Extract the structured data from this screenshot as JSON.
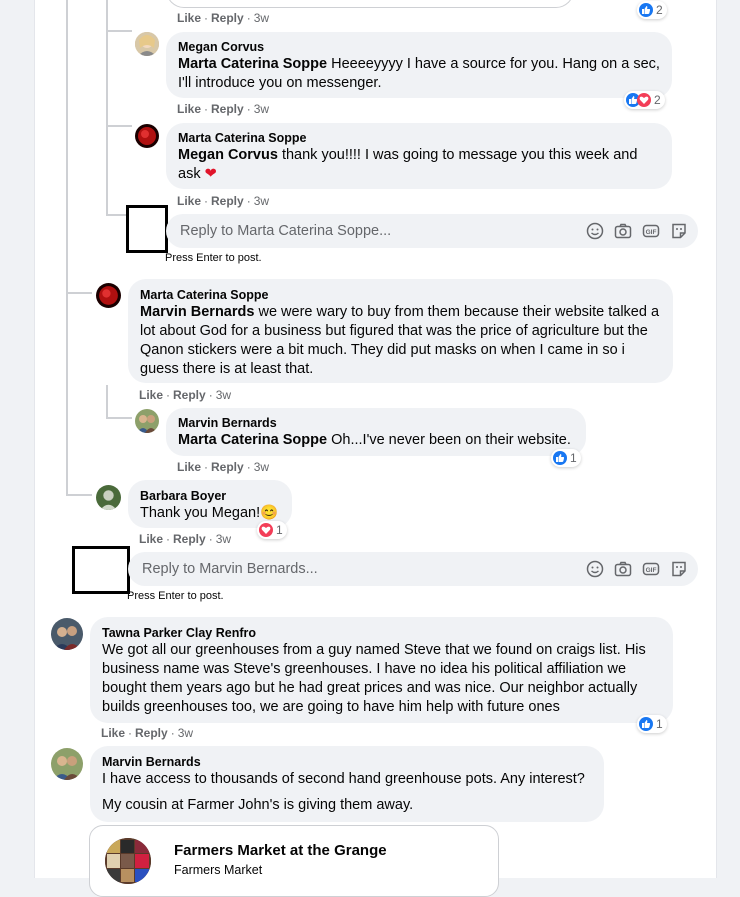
{
  "top_meta": {
    "like": "Like",
    "reply": "Reply",
    "time": "3w",
    "reactions": "2"
  },
  "comments": {
    "c1": {
      "author": "Megan Corvus",
      "tag": "Marta Caterina Soppe",
      "text": " Heeeeyyyy I have a source for you. Hang on a sec, I'll introduce you on messenger.",
      "like": "Like",
      "reply": "Reply",
      "time": "3w",
      "reactions": "2"
    },
    "c2": {
      "author": "Marta Caterina Soppe",
      "tag": "Megan Corvus",
      "text": " thank you!!!! I was going to message you this week and ask ",
      "emoji": "❤",
      "like": "Like",
      "reply": "Reply",
      "time": "3w"
    },
    "c3": {
      "author": "Marta Caterina Soppe",
      "tag": "Marvin Bernards",
      "text": " we were wary to buy from them because their website talked a lot about God for a business but figured that was the price of agriculture but the Qanon stickers were a bit much. They did put masks on when I came in so i guess there is at least that.",
      "like": "Like",
      "reply": "Reply",
      "time": "3w"
    },
    "c4": {
      "author": "Marvin Bernards",
      "tag": "Marta Caterina Soppe",
      "text": " Oh...I've never been on their website.",
      "like": "Like",
      "reply": "Reply",
      "time": "3w",
      "reactions": "1"
    },
    "c5": {
      "author": "Barbara Boyer",
      "text": "Thank you Megan!",
      "emoji": "😊",
      "like": "Like",
      "reply": "Reply",
      "time": "3w",
      "reactions": "1"
    },
    "c6": {
      "author": "Tawna Parker Clay Renfro",
      "text": "We got all our greenhouses from a guy named Steve that we found on craigs list. His business name was Steve's greenhouses. I have no idea his political affiliation we bought them years ago but he had great prices and was nice. Our neighbor actually builds greenhouses too, we are going to have him help with future ones",
      "like": "Like",
      "reply": "Reply",
      "time": "3w",
      "reactions": "1"
    },
    "c7": {
      "author": "Marvin Bernards",
      "line1": "I have access to thousands of second hand greenhouse pots. Any interest?",
      "line2": "My cousin at Farmer John's is giving them away."
    }
  },
  "reply_boxes": {
    "r1": {
      "placeholder": "Reply to Marta Caterina Soppe...",
      "hint": "Press Enter to post."
    },
    "r2": {
      "placeholder": "Reply to Marvin Bernards...",
      "hint": "Press Enter to post."
    }
  },
  "preview": {
    "title": "Farmers Market at the Grange",
    "subtitle": "Farmers Market"
  },
  "colors": {
    "like": "#1877f2",
    "love": "#f33e58",
    "bubble": "#f0f2f5",
    "meta": "#65676b"
  }
}
